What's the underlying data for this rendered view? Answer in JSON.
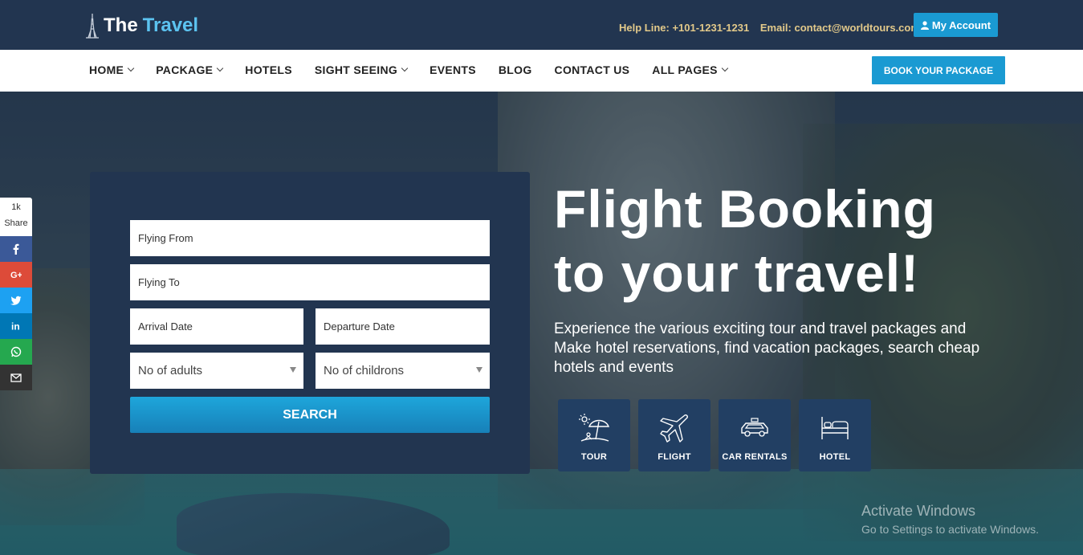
{
  "brand": {
    "name_part1": "The",
    "name_part2": "Travel"
  },
  "topbar": {
    "helpline": "Help Line: +101-1231-1231",
    "email": "Email: contact@worldtours.com",
    "account_label": "My Account"
  },
  "nav": {
    "items": [
      {
        "label": "HOME",
        "dropdown": true
      },
      {
        "label": "PACKAGE",
        "dropdown": true
      },
      {
        "label": "HOTELS",
        "dropdown": false
      },
      {
        "label": "SIGHT SEEING",
        "dropdown": true
      },
      {
        "label": "EVENTS",
        "dropdown": false
      },
      {
        "label": "BLOG",
        "dropdown": false
      },
      {
        "label": "CONTACT US",
        "dropdown": false
      },
      {
        "label": "ALL PAGES",
        "dropdown": true
      }
    ],
    "book_label": "BOOK YOUR PACKAGE"
  },
  "share": {
    "count": "1k",
    "label": "Share",
    "networks": [
      {
        "name": "facebook-icon",
        "color": "#3b5998"
      },
      {
        "name": "google-plus-icon",
        "color": "#dd4b39"
      },
      {
        "name": "twitter-icon",
        "color": "#1da1f2"
      },
      {
        "name": "linkedin-icon",
        "color": "#0077b5"
      },
      {
        "name": "whatsapp-icon",
        "color": "#25a84f"
      },
      {
        "name": "email-icon",
        "color": "#333333"
      }
    ]
  },
  "search": {
    "flying_from": "Flying From",
    "flying_to": "Flying To",
    "arrival_date": "Arrival Date",
    "departure_date": "Departure Date",
    "adults": "No of adults",
    "childrens": "No of childrons",
    "button": "SEARCH"
  },
  "hero": {
    "title_line1": "Flight Booking",
    "title_line2": "to your travel!",
    "subtitle": "Experience the various exciting tour and travel packages and Make hotel reservations, find vacation packages, search cheap hotels and events"
  },
  "tiles": [
    {
      "label": "TOUR",
      "icon": "beach-icon"
    },
    {
      "label": "FLIGHT",
      "icon": "plane-icon"
    },
    {
      "label": "CAR RENTALS",
      "icon": "car-icon"
    },
    {
      "label": "HOTEL",
      "icon": "bed-icon"
    }
  ],
  "watermark": {
    "line1": "Activate Windows",
    "line2": "Go to Settings to activate Windows."
  },
  "colors": {
    "accent": "#1a9ad2",
    "header_bg": "#223550",
    "gold": "#e2c98a"
  }
}
